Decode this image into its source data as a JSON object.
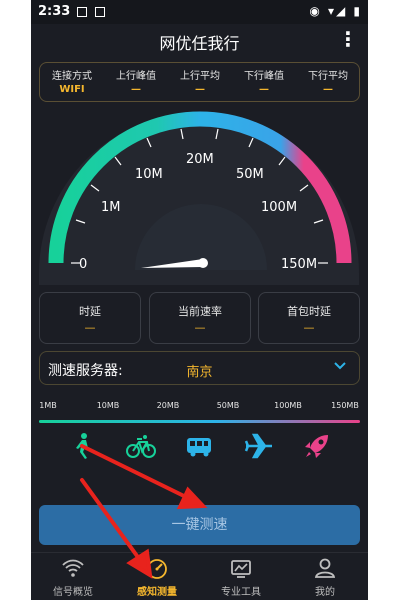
{
  "statusbar": {
    "time": "2:33",
    "right_icons": "◉ ▾◢ ▮"
  },
  "header": {
    "title": "网优任我行",
    "more_icon": "more-vertical-icon"
  },
  "stats": [
    {
      "label": "连接方式",
      "value": "WIFI"
    },
    {
      "label": "上行峰值",
      "value": "—"
    },
    {
      "label": "上行平均",
      "value": "—"
    },
    {
      "label": "下行峰值",
      "value": "—"
    },
    {
      "label": "下行平均",
      "value": "—"
    }
  ],
  "gauge": {
    "ticks": [
      "0",
      "1M",
      "10M",
      "20M",
      "50M",
      "100M",
      "150M"
    ],
    "current_value": 0,
    "colors": {
      "start": "#17d19a",
      "mid": "#2db3e8",
      "end": "#e9428a"
    }
  },
  "metrics": [
    {
      "label": "时延",
      "value": "—"
    },
    {
      "label": "当前速率",
      "value": "—"
    },
    {
      "label": "首包时延",
      "value": "—"
    }
  ],
  "server": {
    "label": "测速服务器:",
    "city": "南京"
  },
  "scale_labels": [
    "1MB",
    "10MB",
    "20MB",
    "50MB",
    "100MB",
    "150MB"
  ],
  "modes": [
    {
      "icon": "walk-icon",
      "color": "#17d19a"
    },
    {
      "icon": "bicycle-icon",
      "color": "#17d19a"
    },
    {
      "icon": "bus-icon",
      "color": "#2db3e8"
    },
    {
      "icon": "airplane-icon",
      "color": "#2db3e8"
    },
    {
      "icon": "rocket-icon",
      "color": "#e9428a"
    }
  ],
  "start_button": {
    "label": "一键测速"
  },
  "tabs": [
    {
      "label": "信号概览",
      "icon": "wifi-icon",
      "active": false
    },
    {
      "label": "感知测量",
      "icon": "speedometer-icon",
      "active": true
    },
    {
      "label": "专业工具",
      "icon": "tools-icon",
      "active": false
    },
    {
      "label": "我的",
      "icon": "user-icon",
      "active": false
    }
  ],
  "accent": "#f5b72e"
}
